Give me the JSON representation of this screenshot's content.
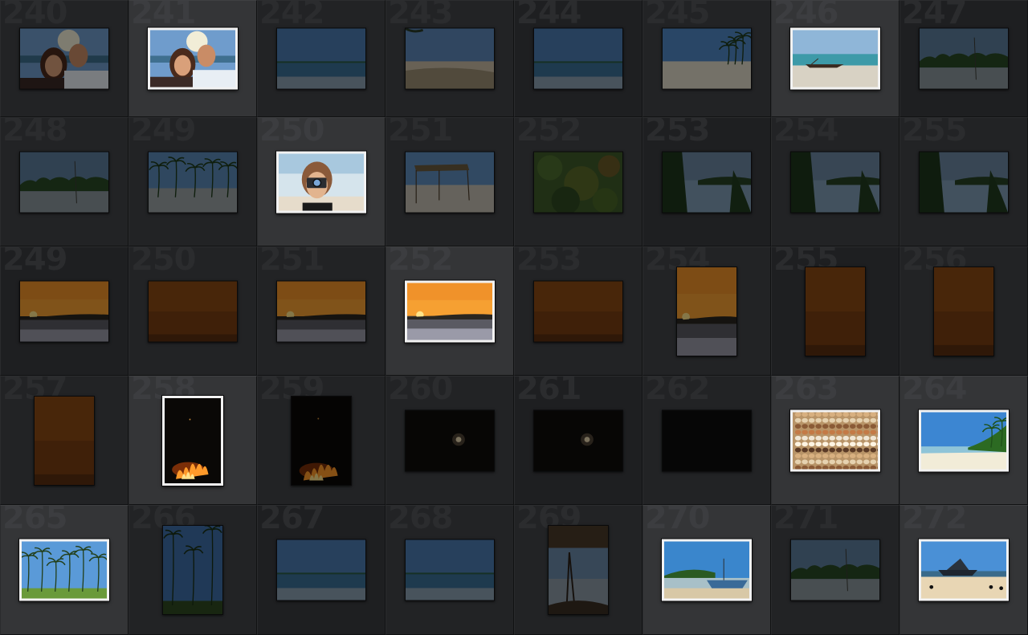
{
  "grid": {
    "cells": [
      {
        "number": "240",
        "picked": false,
        "orient": "land",
        "scene": "couple"
      },
      {
        "number": "241",
        "picked": true,
        "orient": "land",
        "scene": "couple"
      },
      {
        "number": "242",
        "picked": false,
        "orient": "land",
        "scene": "sea"
      },
      {
        "number": "243",
        "picked": false,
        "orient": "land",
        "scene": "beach"
      },
      {
        "number": "244",
        "picked": false,
        "orient": "land",
        "scene": "sea"
      },
      {
        "number": "245",
        "picked": false,
        "orient": "land",
        "scene": "palm-shore"
      },
      {
        "number": "246",
        "picked": true,
        "orient": "land",
        "scene": "boat"
      },
      {
        "number": "247",
        "picked": false,
        "orient": "land",
        "scene": "treeline"
      },
      {
        "number": "248",
        "picked": false,
        "orient": "land",
        "scene": "treeline"
      },
      {
        "number": "249",
        "picked": false,
        "orient": "land",
        "scene": "palms"
      },
      {
        "number": "250",
        "picked": true,
        "orient": "land",
        "scene": "photographer"
      },
      {
        "number": "251",
        "picked": false,
        "orient": "land",
        "scene": "hut"
      },
      {
        "number": "252",
        "picked": false,
        "orient": "land",
        "scene": "leaves"
      },
      {
        "number": "253",
        "picked": false,
        "orient": "land",
        "scene": "trees-water"
      },
      {
        "number": "254",
        "picked": false,
        "orient": "land",
        "scene": "trees-water"
      },
      {
        "number": "255",
        "picked": false,
        "orient": "land",
        "scene": "trees-water"
      },
      {
        "number": "249",
        "picked": false,
        "orient": "land",
        "scene": "sunset"
      },
      {
        "number": "250",
        "picked": false,
        "orient": "land",
        "scene": "dusk"
      },
      {
        "number": "251",
        "picked": false,
        "orient": "land",
        "scene": "sunset"
      },
      {
        "number": "252",
        "picked": true,
        "orient": "land",
        "scene": "sunset"
      },
      {
        "number": "253",
        "picked": false,
        "orient": "land",
        "scene": "dusk"
      },
      {
        "number": "254",
        "picked": false,
        "orient": "port",
        "scene": "sunset"
      },
      {
        "number": "255",
        "picked": false,
        "orient": "port",
        "scene": "dusk"
      },
      {
        "number": "256",
        "picked": false,
        "orient": "port",
        "scene": "dusk"
      },
      {
        "number": "257",
        "picked": false,
        "orient": "port",
        "scene": "dusk"
      },
      {
        "number": "258",
        "picked": true,
        "orient": "port",
        "scene": "fire"
      },
      {
        "number": "259",
        "picked": false,
        "orient": "port",
        "scene": "fire"
      },
      {
        "number": "260",
        "picked": false,
        "orient": "land",
        "scene": "night-light"
      },
      {
        "number": "261",
        "picked": false,
        "orient": "land",
        "scene": "night-light"
      },
      {
        "number": "262",
        "picked": false,
        "orient": "land",
        "scene": "night"
      },
      {
        "number": "263",
        "picked": true,
        "orient": "land",
        "scene": "shells"
      },
      {
        "number": "264",
        "picked": true,
        "orient": "land",
        "scene": "bright-beach"
      },
      {
        "number": "265",
        "picked": true,
        "orient": "land",
        "scene": "palm-grove"
      },
      {
        "number": "266",
        "picked": false,
        "orient": "port",
        "scene": "palms-port"
      },
      {
        "number": "267",
        "picked": false,
        "orient": "land",
        "scene": "sea"
      },
      {
        "number": "268",
        "picked": false,
        "orient": "land",
        "scene": "sea"
      },
      {
        "number": "269",
        "picked": false,
        "orient": "port",
        "scene": "hut-port"
      },
      {
        "number": "270",
        "picked": true,
        "orient": "land",
        "scene": "boats"
      },
      {
        "number": "271",
        "picked": false,
        "orient": "land",
        "scene": "treeline"
      },
      {
        "number": "272",
        "picked": true,
        "orient": "land",
        "scene": "ship-beach"
      }
    ]
  }
}
